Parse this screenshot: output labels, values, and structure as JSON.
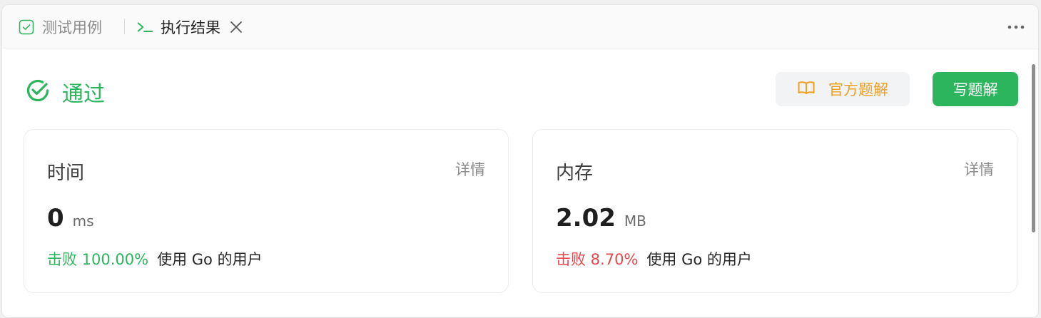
{
  "tabs": {
    "testcases_label": "测试用例",
    "result_label": "执行结果"
  },
  "status": {
    "label": "通过",
    "color": "#2db55d"
  },
  "actions": {
    "official_solutions_label": "官方题解",
    "write_solution_label": "写题解"
  },
  "time_card": {
    "title": "时间",
    "detail_label": "详情",
    "value": "0",
    "unit": "ms",
    "beats_prefix": "击败 100.00%",
    "beats_suffix": "使用 Go 的用户"
  },
  "memory_card": {
    "title": "内存",
    "detail_label": "详情",
    "value": "2.02",
    "unit": "MB",
    "beats_prefix": "击败 8.70%",
    "beats_suffix": "使用 Go 的用户"
  },
  "icons": {
    "testcases": "checkbox-icon",
    "result": "terminal-icon",
    "close": "close-icon",
    "more": "more-horizontal-icon",
    "status": "check-circle-icon",
    "solutions": "book-icon"
  },
  "colors": {
    "accent_green": "#2db55d",
    "accent_orange": "#f0a020",
    "beats_bad_red": "#e5484d"
  }
}
